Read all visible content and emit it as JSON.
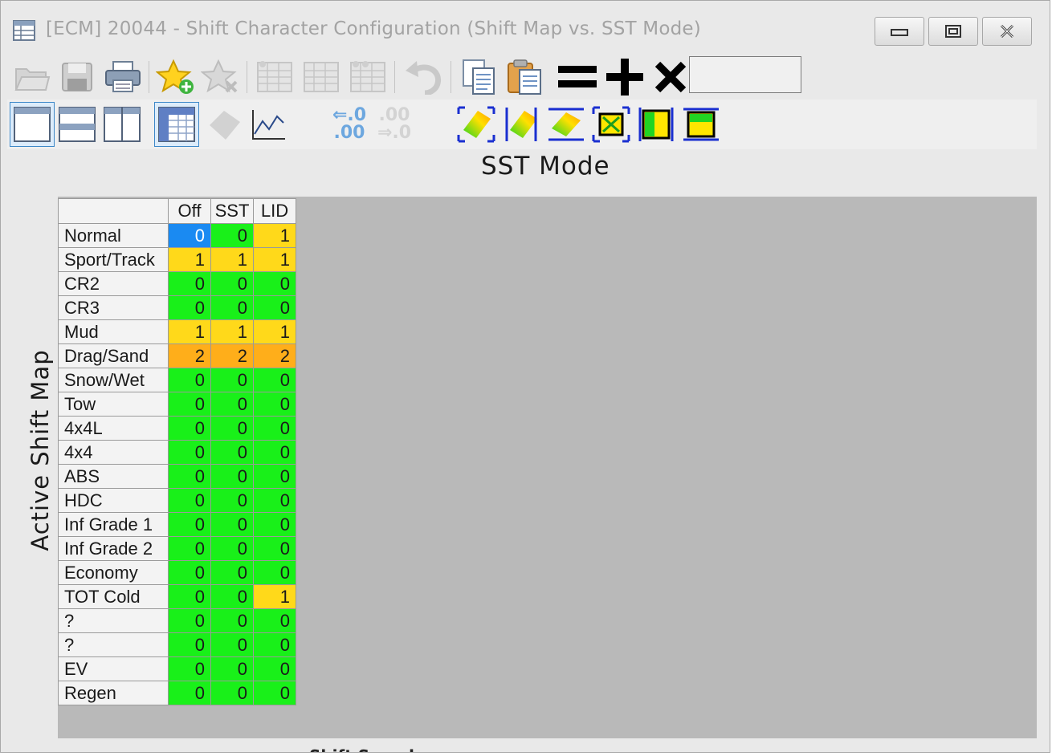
{
  "window": {
    "title": "[ECM] 20044 - Shift Character Configuration (Shift Map vs. SST Mode)"
  },
  "toolbar": {
    "items": [
      "open-folder-icon",
      "save-icon",
      "print-icon",
      "add-favorite-icon",
      "remove-favorite-icon",
      "table-copy-icon",
      "table-paste-icon",
      "table-compare-icon",
      "undo-icon",
      "copy-icon",
      "paste-icon",
      "equals-icon",
      "plus-icon",
      "multiply-icon"
    ],
    "operand_value": ""
  },
  "toolbar2": {
    "decimal_inc": ".0",
    "decimal_inc2": ".00",
    "decimal_dec": ".00",
    "decimal_dec2": ".0"
  },
  "colors": {
    "zero": "#19f019",
    "one": "#ffd91a",
    "two": "#ffae1a",
    "selected": "#1a8af2",
    "background": "#b9b9b9"
  },
  "table": {
    "column_axis_title": "SST Mode",
    "row_axis_title": "Active Shift Map",
    "columns": [
      "Off",
      "SST",
      "LID"
    ],
    "rows": [
      {
        "label": "Normal",
        "values": [
          "0",
          "0",
          "1"
        ]
      },
      {
        "label": "Sport/Track",
        "values": [
          "1",
          "1",
          "1"
        ]
      },
      {
        "label": "CR2",
        "values": [
          "0",
          "0",
          "0"
        ]
      },
      {
        "label": "CR3",
        "values": [
          "0",
          "0",
          "0"
        ]
      },
      {
        "label": "Mud",
        "values": [
          "1",
          "1",
          "1"
        ]
      },
      {
        "label": "Drag/Sand",
        "values": [
          "2",
          "2",
          "2"
        ]
      },
      {
        "label": "Snow/Wet",
        "values": [
          "0",
          "0",
          "0"
        ]
      },
      {
        "label": "Tow",
        "values": [
          "0",
          "0",
          "0"
        ]
      },
      {
        "label": "4x4L",
        "values": [
          "0",
          "0",
          "0"
        ]
      },
      {
        "label": "4x4",
        "values": [
          "0",
          "0",
          "0"
        ]
      },
      {
        "label": "ABS",
        "values": [
          "0",
          "0",
          "0"
        ]
      },
      {
        "label": "HDC",
        "values": [
          "0",
          "0",
          "0"
        ]
      },
      {
        "label": "Inf Grade 1",
        "values": [
          "0",
          "0",
          "0"
        ]
      },
      {
        "label": "Inf Grade 2",
        "values": [
          "0",
          "0",
          "0"
        ]
      },
      {
        "label": "Economy",
        "values": [
          "0",
          "0",
          "0"
        ]
      },
      {
        "label": "TOT Cold",
        "values": [
          "0",
          "0",
          "1"
        ]
      },
      {
        "label": "?",
        "values": [
          "0",
          "0",
          "0"
        ]
      },
      {
        "label": "?",
        "values": [
          "0",
          "0",
          "0"
        ]
      },
      {
        "label": "EV",
        "values": [
          "0",
          "0",
          "0"
        ]
      },
      {
        "label": "Regen",
        "values": [
          "0",
          "0",
          "0"
        ]
      }
    ]
  },
  "footer": {
    "partial_label": "Shift Speed"
  }
}
